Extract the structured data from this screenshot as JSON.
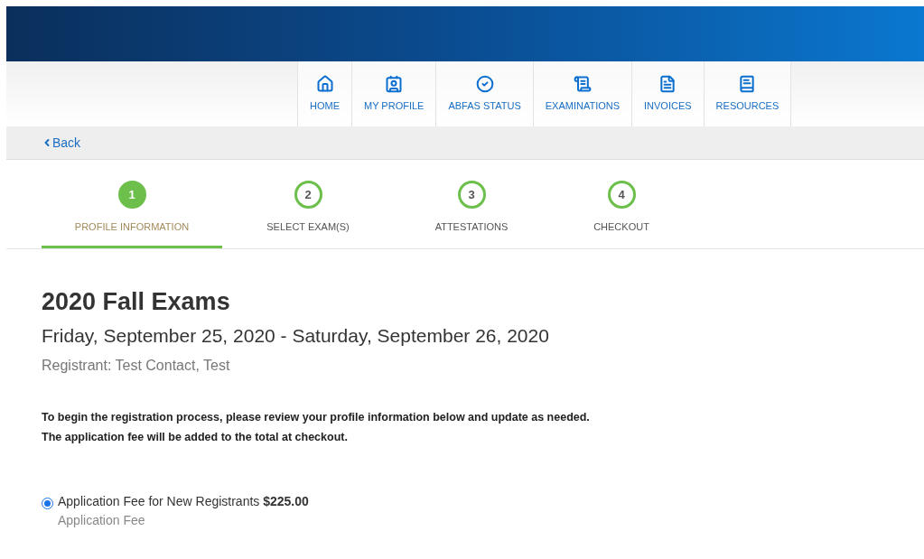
{
  "nav": [
    {
      "label": "HOME"
    },
    {
      "label": "MY PROFILE"
    },
    {
      "label": "ABFAS STATUS"
    },
    {
      "label": "EXAMINATIONS"
    },
    {
      "label": "INVOICES"
    },
    {
      "label": "RESOURCES"
    }
  ],
  "back_link": "Back",
  "steps": [
    {
      "number": "1",
      "label": "PROFILE INFORMATION",
      "selected": true
    },
    {
      "number": "2",
      "label": "SELECT EXAM(S)",
      "selected": false
    },
    {
      "number": "3",
      "label": "ATTESTATIONS",
      "selected": false
    },
    {
      "number": "4",
      "label": "CHECKOUT",
      "selected": false
    }
  ],
  "title": "2020 Fall Exams",
  "dates": "Friday, September 25, 2020 - Saturday, September 26, 2020",
  "registrant": "Registrant: Test Contact, Test",
  "instructions": [
    "To begin the registration process, please review your profile information below and update as needed.",
    "The application fee will be added to the total at checkout."
  ],
  "fees": [
    {
      "label": "Application Fee for New Registrants **$225.00**",
      "description": "Application Fee",
      "selected": true
    }
  ]
}
